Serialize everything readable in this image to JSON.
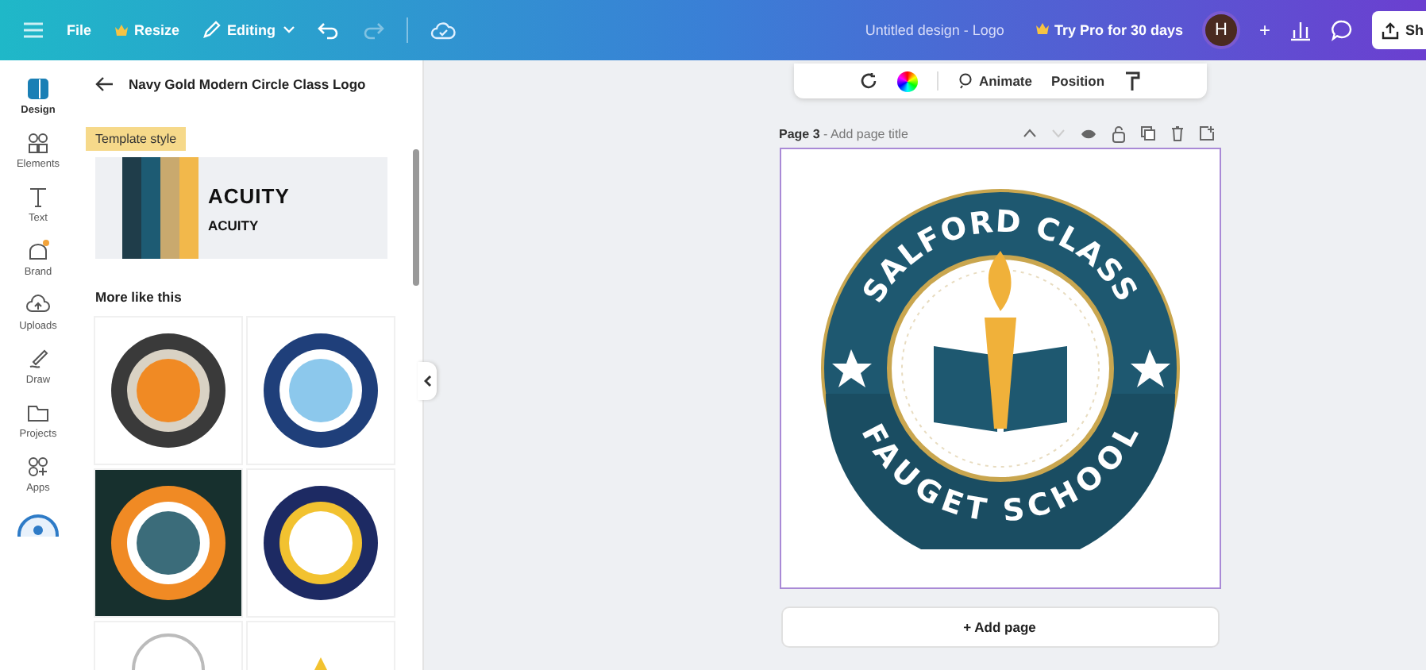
{
  "top_bar": {
    "menu": [
      "File",
      "Resize"
    ],
    "mode": "Editing",
    "history": [
      {
        "kind": "undo",
        "disabled": false
      },
      {
        "kind": "redo",
        "disabled": true
      }
    ],
    "document_title": "Untitled design - Logo",
    "pro_offer": "Try Pro for 30 days",
    "avatar": "H",
    "add": "+",
    "share": "Sh"
  },
  "rail": [
    {
      "label": "Design",
      "selected": true
    },
    {
      "label": "Elements",
      "selected": false
    },
    {
      "label": "Text",
      "selected": false
    },
    {
      "label": "Brand",
      "selected": false
    },
    {
      "label": "Uploads",
      "selected": false
    },
    {
      "label": "Draw",
      "selected": false
    },
    {
      "label": "Projects",
      "selected": false
    },
    {
      "label": "Apps",
      "selected": false
    }
  ],
  "panel": {
    "title": "Navy Gold Modern Circle Class Logo",
    "style_label": "Template style",
    "style_card": {
      "heading": "ACUITY",
      "subheading": "ACUITY"
    },
    "more_heading": "More like this",
    "thumbnails": [
      {
        "kind": "orange",
        "dark": false
      },
      {
        "kind": "blue",
        "dark": false
      },
      {
        "kind": "mountain",
        "dark": true
      },
      {
        "kind": "navy",
        "dark": false
      }
    ]
  },
  "element_toolbar": [
    "Animate",
    "Position"
  ],
  "page": {
    "label": "Page 3",
    "title_placeholder": "- Add page title",
    "logo": {
      "top_text": "SALFORD CLASS",
      "bottom_text": "FAUGET SCHOOL"
    }
  },
  "add_page": "+ Add page"
}
